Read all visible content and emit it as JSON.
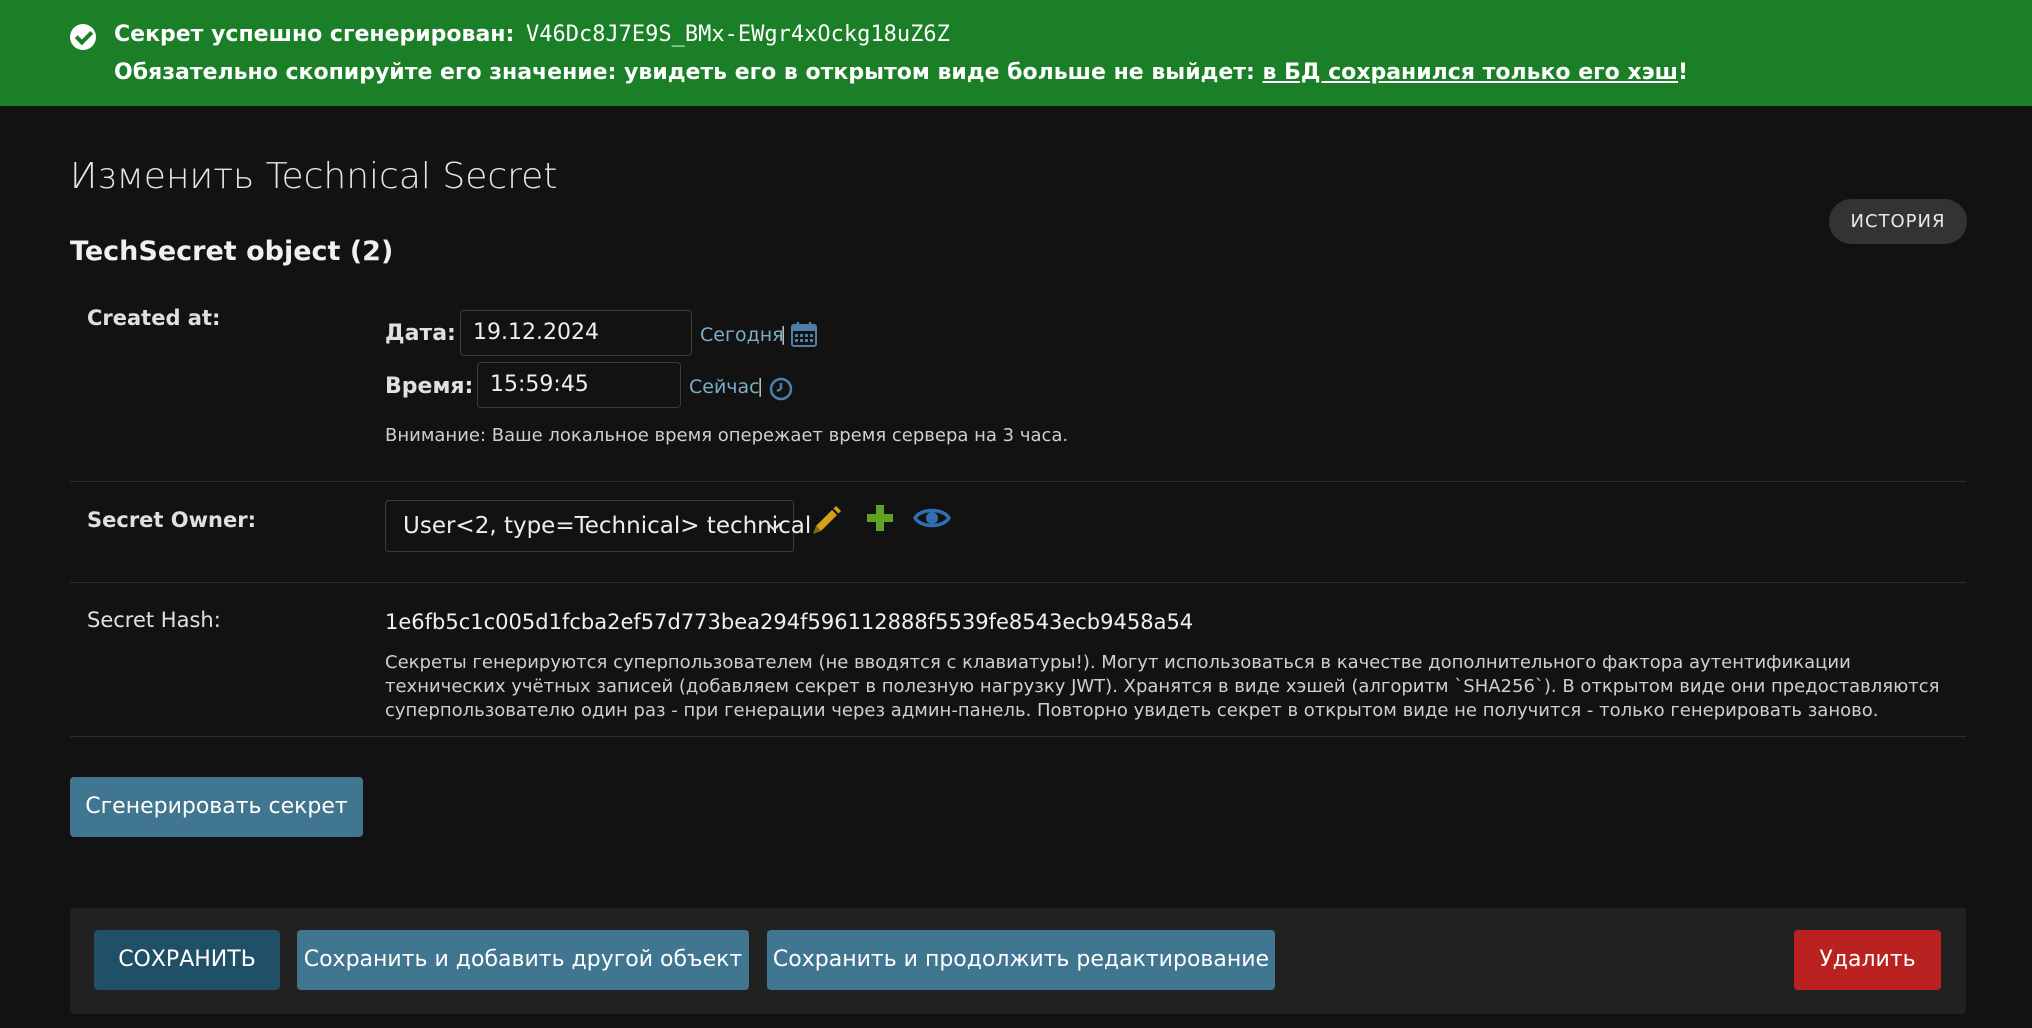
{
  "banner": {
    "line1_label": "Секрет успешно сгенерирован:",
    "secret_value": "V46Dc8J7E9S_BMx-EWgr4xOckg18uZ6Z",
    "line2_text": "Обязательно скопируйте его значение: увидеть его в открытом виде больше не выйдет: ",
    "line2_link": "в БД сохранился только его хэш",
    "line2_end": "!",
    "colors": {
      "background": "#1b7f28"
    }
  },
  "page": {
    "title": "Изменить Technical Secret",
    "object_title": "TechSecret object (2)",
    "history_button": "ИСТОРИЯ"
  },
  "created_at": {
    "label": "Created at:",
    "date_label": "Дата:",
    "date_value": "19.12.2024",
    "today_link": "Сегодня",
    "separator": "|",
    "time_label": "Время:",
    "time_value": "15:59:45",
    "now_link": "Сейчас",
    "timezone_warning": "Внимание: Ваше локальное время опережает время сервера на 3 часа."
  },
  "secret_owner": {
    "label": "Secret Owner:",
    "selected": "User<2, type=Technical> technical",
    "icons": [
      "pencil-icon",
      "plus-icon",
      "eye-icon"
    ]
  },
  "secret_hash": {
    "label": "Secret Hash:",
    "value": "1e6fb5c1c005d1fcba2ef57d773bea294f596112888f5539fe8543ecb9458a54",
    "help_text": "Секреты генерируются суперпользователем (не вводятся с клавиатуры!). Могут использоваться в качестве дополнительного фактора аутентификации технических учётных записей (добавляем секрет в полезную нагрузку JWT). Хранятся в виде хэшей (алгоритм `SHA256`). В открытом виде они предоставляются суперпользователю один раз - при генерации через админ-панель. Повторно увидеть секрет в открытом виде не получится - только генерировать заново."
  },
  "actions": {
    "generate": "Сгенерировать секрет",
    "save": "СОХРАНИТЬ",
    "save_add_another": "Сохранить и добавить другой объект",
    "save_continue": "Сохранить и продолжить редактирование",
    "delete": "Удалить"
  },
  "colors": {
    "background": "#121212",
    "primary_button": "#417690",
    "save_button": "#205067",
    "delete_button": "#ba2121",
    "link": "#79aec8",
    "edit_icon": "#d4a017",
    "add_icon": "#5fa225",
    "view_icon": "#2e6fb6"
  }
}
